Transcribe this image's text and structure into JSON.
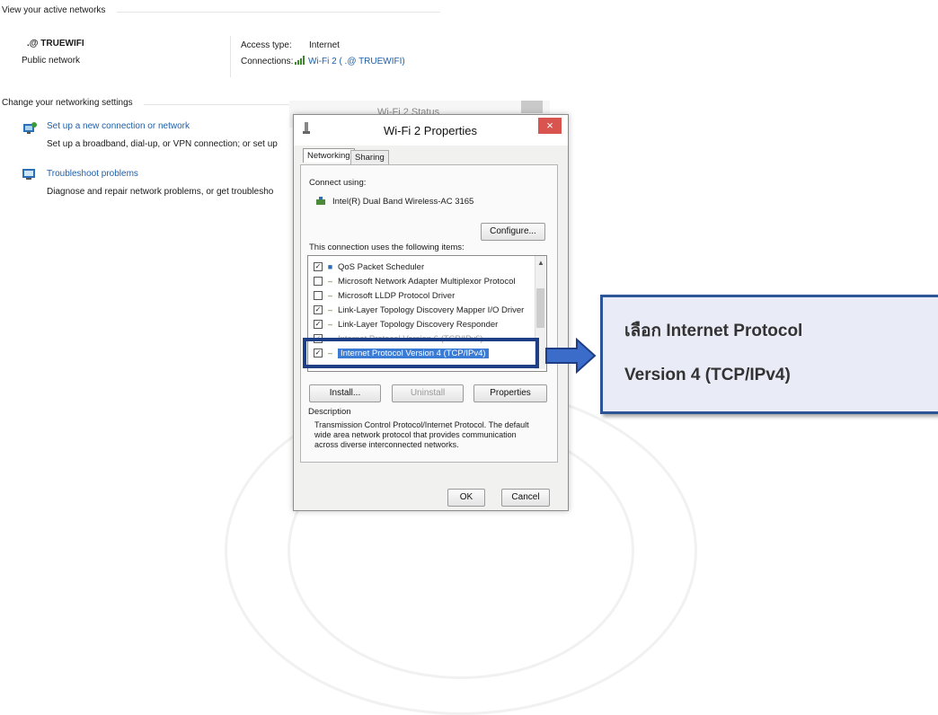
{
  "active_networks": {
    "heading": "View your active networks",
    "network_name": ".@ TRUEWIFI",
    "network_type": "Public network",
    "access_type_label": "Access type:",
    "access_type_value": "Internet",
    "connections_label": "Connections:",
    "connections_value": "Wi-Fi 2 ( .@ TRUEWIFI)"
  },
  "settings": {
    "heading": "Change your networking settings",
    "items": [
      {
        "title": "Set up a new connection or network",
        "desc": "Set up a broadband, dial-up, or VPN connection; or set up",
        "icon": "network-setup-icon"
      },
      {
        "title": "Troubleshoot problems",
        "desc": "Diagnose and repair network problems, or get troublesho",
        "icon": "troubleshoot-icon"
      }
    ]
  },
  "background_window_title": "Wi-Fi 2 Status",
  "dialog": {
    "title": "Wi-Fi 2 Properties",
    "close_label": "×",
    "tabs": [
      "Networking",
      "Sharing"
    ],
    "connect_using_label": "Connect using:",
    "adapter": "Intel(R) Dual Band Wireless-AC 3165",
    "configure_label": "Configure...",
    "items_label": "This connection uses the following items:",
    "items": [
      {
        "label": "QoS Packet Scheduler",
        "checked": true
      },
      {
        "label": "Microsoft Network Adapter Multiplexor Protocol",
        "checked": false
      },
      {
        "label": "Microsoft LLDP Protocol Driver",
        "checked": false
      },
      {
        "label": "Link-Layer Topology Discovery Mapper I/O Driver",
        "checked": true
      },
      {
        "label": "Link-Layer Topology Discovery Responder",
        "checked": true
      },
      {
        "label": "Internet Protocol Version 6 (TCP/IPv6)",
        "checked": true
      },
      {
        "label": "Internet Protocol Version 4 (TCP/IPv4)",
        "checked": true,
        "selected": true
      }
    ],
    "install_label": "Install...",
    "uninstall_label": "Uninstall",
    "properties_label": "Properties",
    "description_label": "Description",
    "description_text": "Transmission Control Protocol/Internet Protocol. The default wide area network protocol that provides communication across diverse interconnected networks.",
    "ok_label": "OK",
    "cancel_label": "Cancel"
  },
  "callout": {
    "line1": "เลือก Internet Protocol",
    "line2": "Version 4 (TCP/IPv4)"
  },
  "colors": {
    "link": "#1f5fa8",
    "callout_border": "#2b5596",
    "callout_fill": "#e9ebf7",
    "highlight_box": "#1e3f86",
    "selection": "#3a7bd5",
    "close_red": "#d9534f"
  }
}
